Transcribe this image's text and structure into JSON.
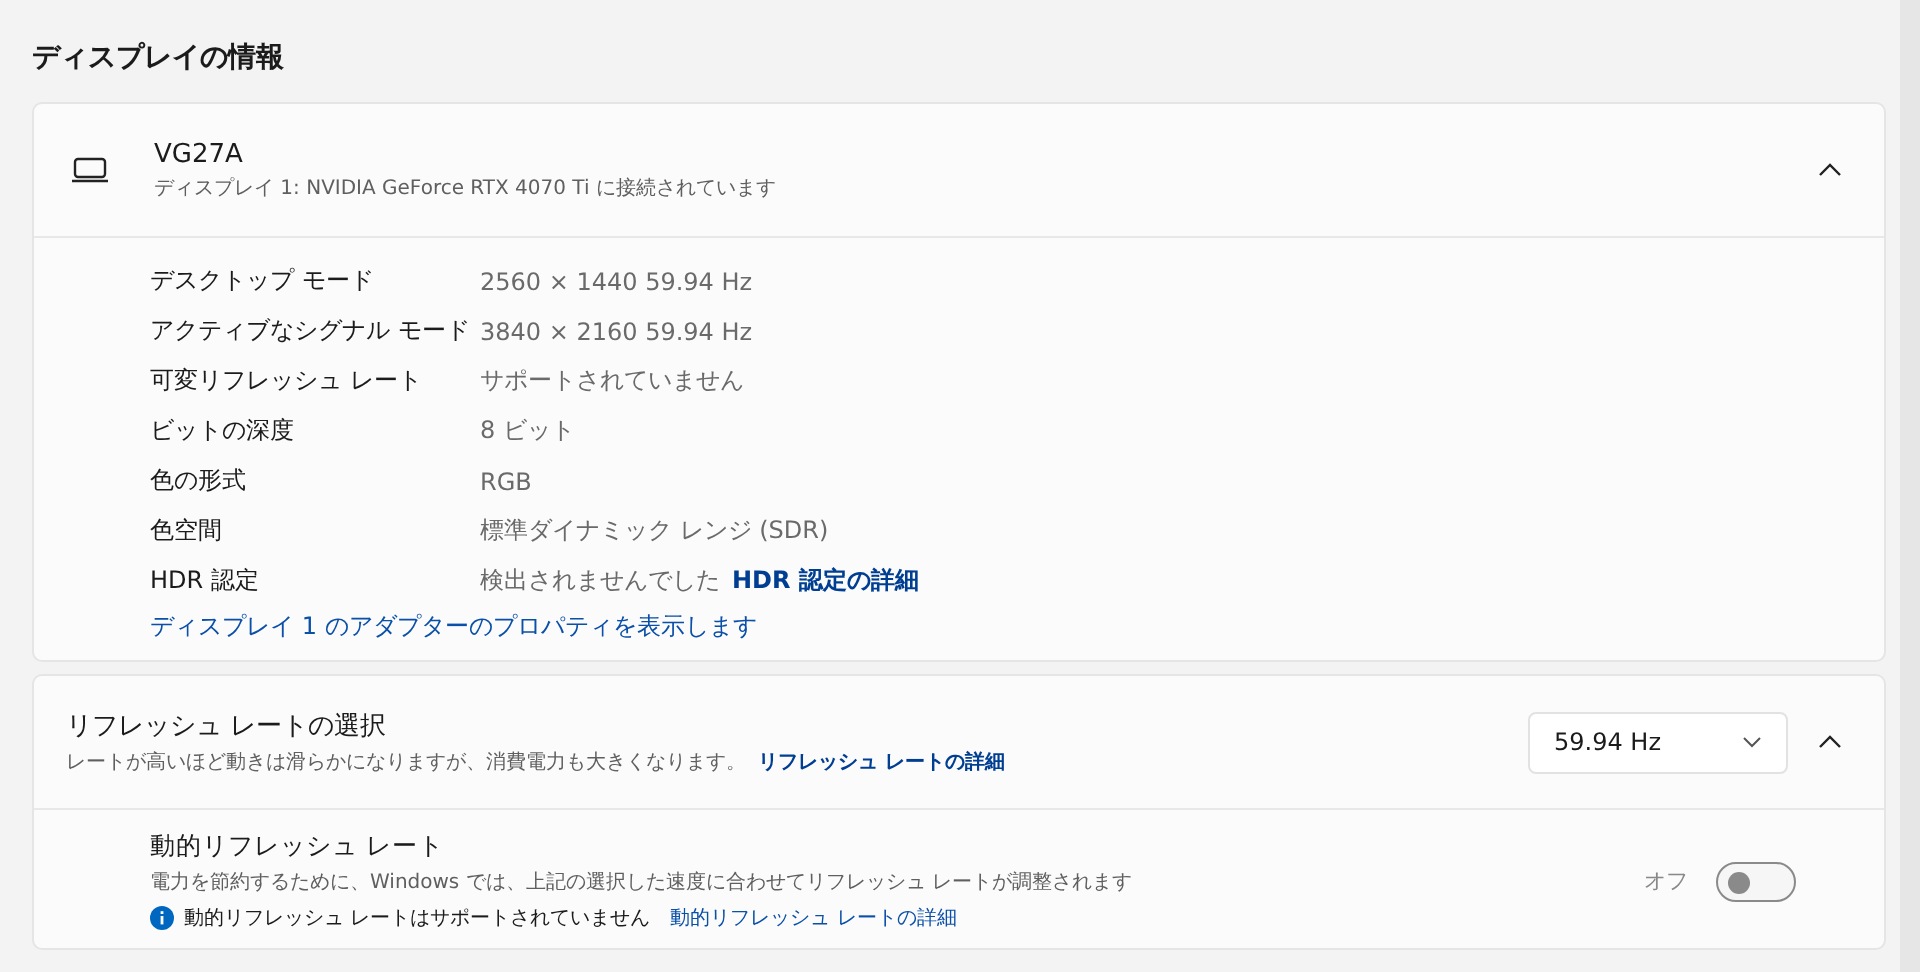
{
  "section_title": "ディスプレイの情報",
  "display_card": {
    "name": "VG27A",
    "subtitle": "ディスプレイ 1: NVIDIA GeForce RTX 4070 Ti に接続されています",
    "expanded": true,
    "details": [
      {
        "label": "デスクトップ モード",
        "value": "2560 × 1440 59.94 Hz"
      },
      {
        "label": "アクティブなシグナル モード",
        "value": "3840 × 2160 59.94 Hz"
      },
      {
        "label": "可変リフレッシュ レート",
        "value": "サポートされていません"
      },
      {
        "label": "ビットの深度",
        "value": "8 ビット"
      },
      {
        "label": "色の形式",
        "value": "RGB"
      },
      {
        "label": "色空間",
        "value": "標準ダイナミック レンジ (SDR)"
      },
      {
        "label": "HDR 認定",
        "value": "検出されませんでした",
        "link": "HDR 認定の詳細"
      }
    ],
    "adapter_link": "ディスプレイ 1 のアダプターのプロパティを表示します"
  },
  "refresh_card": {
    "title": "リフレッシュ レートの選択",
    "description": "レートが高いほど動きは滑らかになりますが、消費電力も大きくなります。",
    "link": "リフレッシュ レートの詳細",
    "dropdown": "59.94 Hz",
    "expanded": true,
    "dynamic": {
      "title": "動的リフレッシュ レート",
      "description": "電力を節約するために、Windows では、上記の選択した速度に合わせてリフレッシュ レートが調整されます",
      "info": "動的リフレッシュ レートはサポートされていません",
      "info_link": "動的リフレッシュ レートの詳細",
      "toggle_label": "オフ",
      "on": false
    }
  }
}
